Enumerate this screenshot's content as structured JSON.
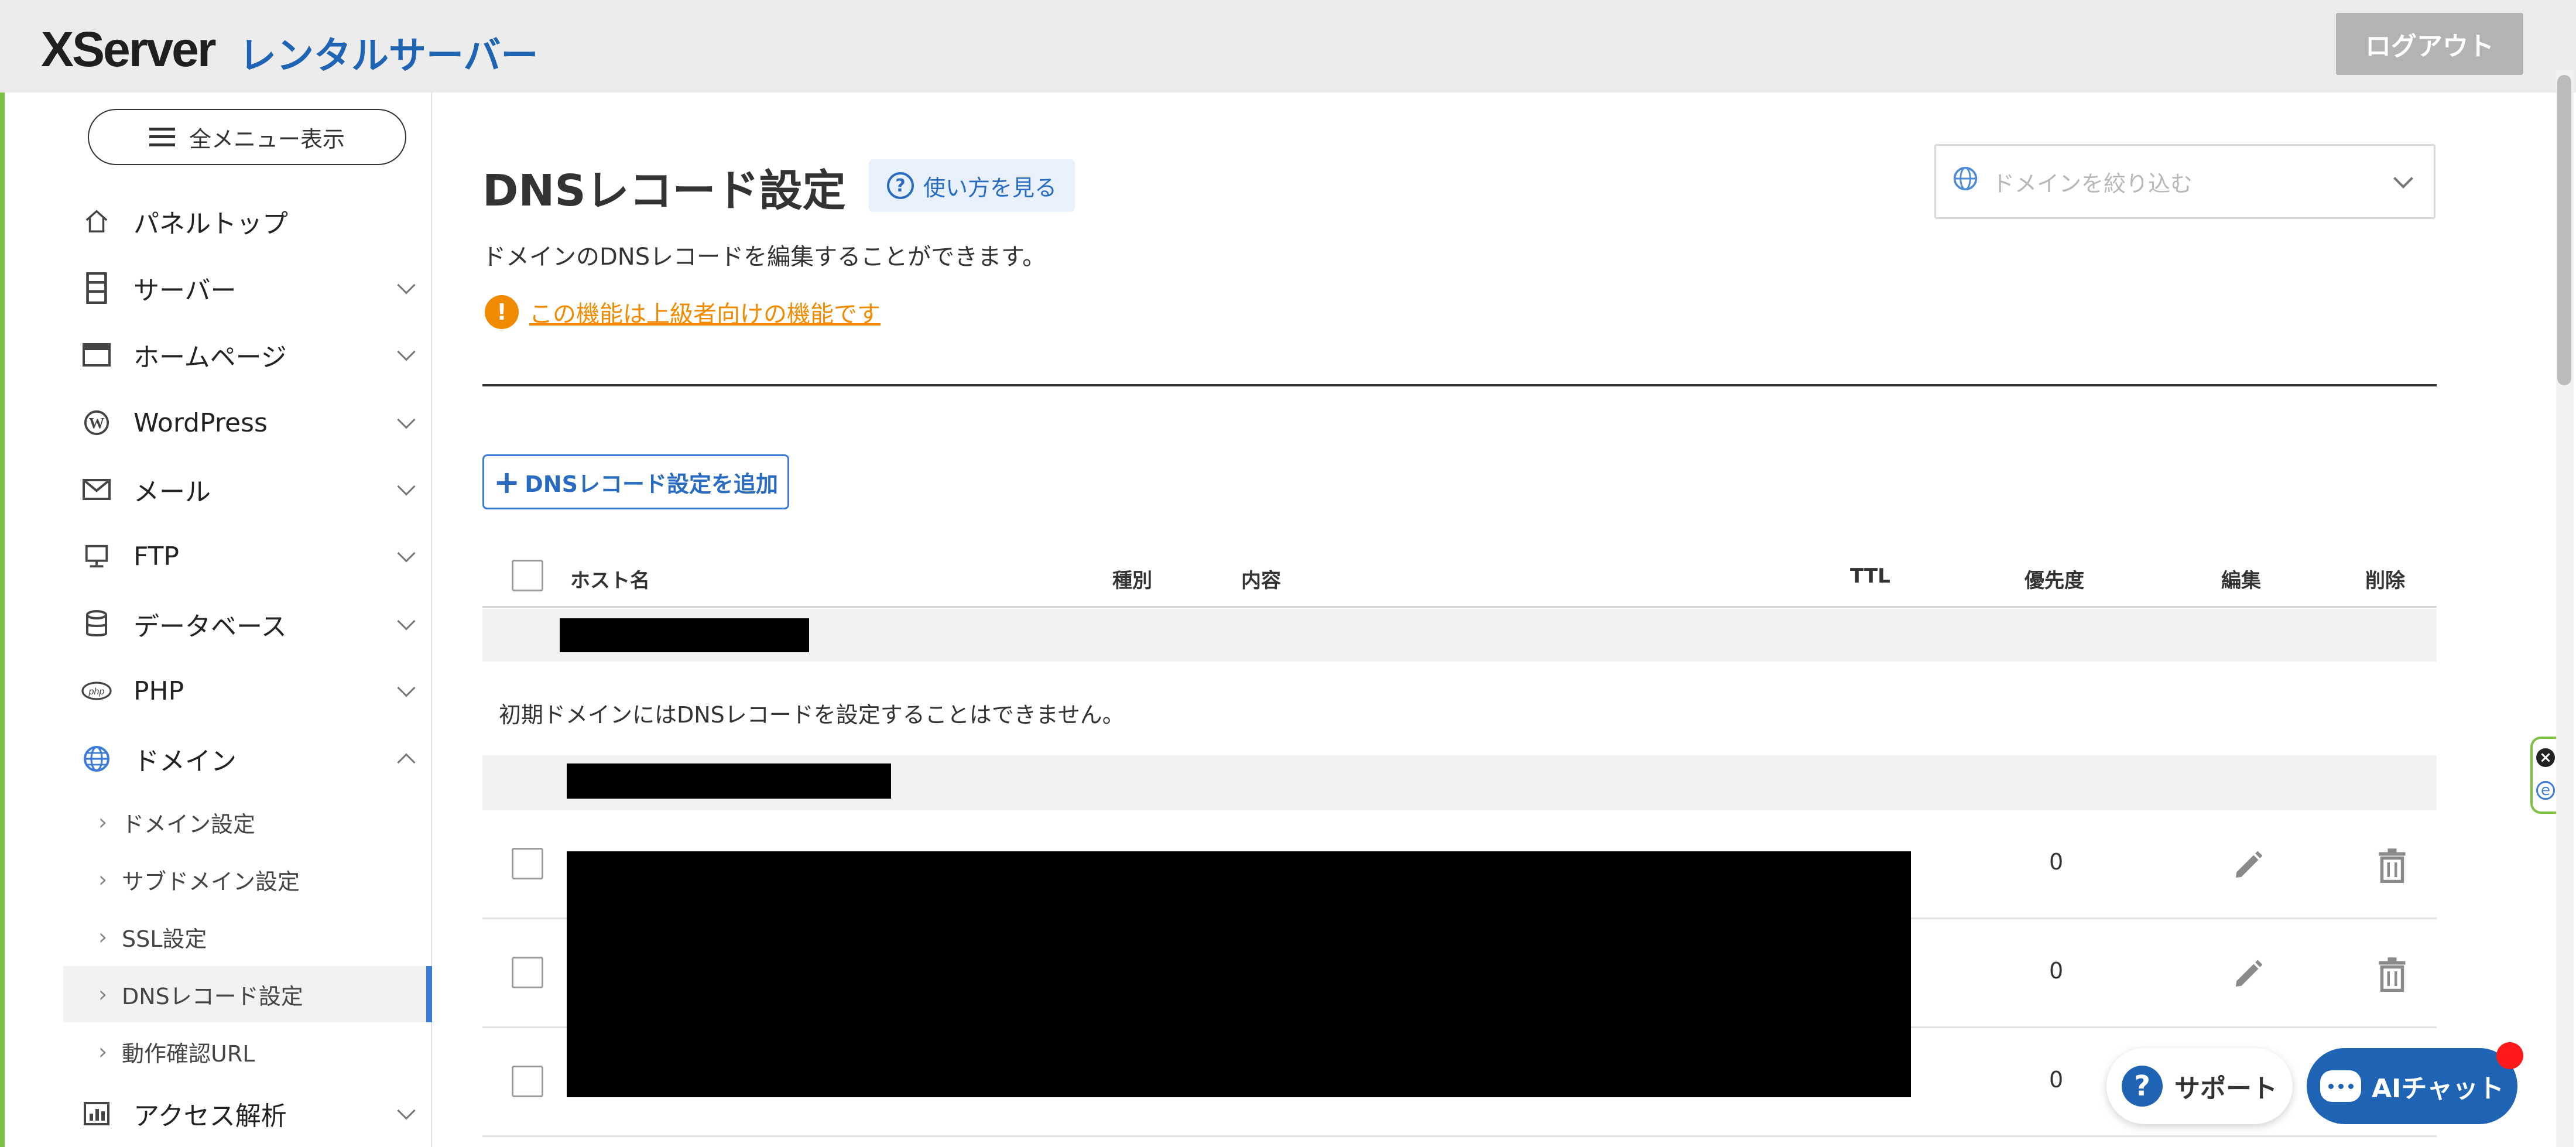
{
  "header": {
    "logo": "XServer",
    "logo_sub": "レンタルサーバー",
    "logout_label": "ログアウト"
  },
  "sidebar": {
    "menu_button_label": "全メニュー表示",
    "items": [
      {
        "label": "パネルトップ",
        "icon": "home-icon"
      },
      {
        "label": "サーバー",
        "icon": "server-icon"
      },
      {
        "label": "ホームページ",
        "icon": "window-icon"
      },
      {
        "label": "WordPress",
        "icon": "wordpress-icon"
      },
      {
        "label": "メール",
        "icon": "mail-icon"
      },
      {
        "label": "FTP",
        "icon": "monitor-icon"
      },
      {
        "label": "データベース",
        "icon": "database-icon"
      },
      {
        "label": "PHP",
        "icon": "php-icon"
      },
      {
        "label": "ドメイン",
        "icon": "globe-icon"
      },
      {
        "label": "アクセス解析",
        "icon": "chart-icon"
      }
    ],
    "sub_items": [
      {
        "label": "ドメイン設定"
      },
      {
        "label": "サブドメイン設定"
      },
      {
        "label": "SSL設定"
      },
      {
        "label": "DNSレコード設定"
      },
      {
        "label": "動作確認URL"
      }
    ]
  },
  "main": {
    "title": "DNSレコード設定",
    "howto_label": "使い方を見る",
    "domain_filter_placeholder": "ドメインを絞り込む",
    "description": "ドメインのDNSレコードを編集することができます。",
    "warning_link": "この機能は上級者向けの機能です",
    "add_button_label": "DNSレコード設定を追加",
    "table": {
      "columns": [
        "ホスト名",
        "種別",
        "内容",
        "TTL",
        "優先度",
        "編集",
        "削除"
      ],
      "initial_domain_note": "初期ドメインにはDNSレコードを設定することはできません。",
      "rows": [
        {
          "priority": "0"
        },
        {
          "priority": "0"
        },
        {
          "priority": "0"
        }
      ]
    }
  },
  "floating": {
    "support_label": "サポート",
    "ai_chat_label": "AIチャット"
  },
  "colors": {
    "brand_blue": "#1f64b4",
    "accent_blue": "#3d7bd9",
    "warning_orange": "#f08a00",
    "logout_gray": "#b3b3b3"
  }
}
